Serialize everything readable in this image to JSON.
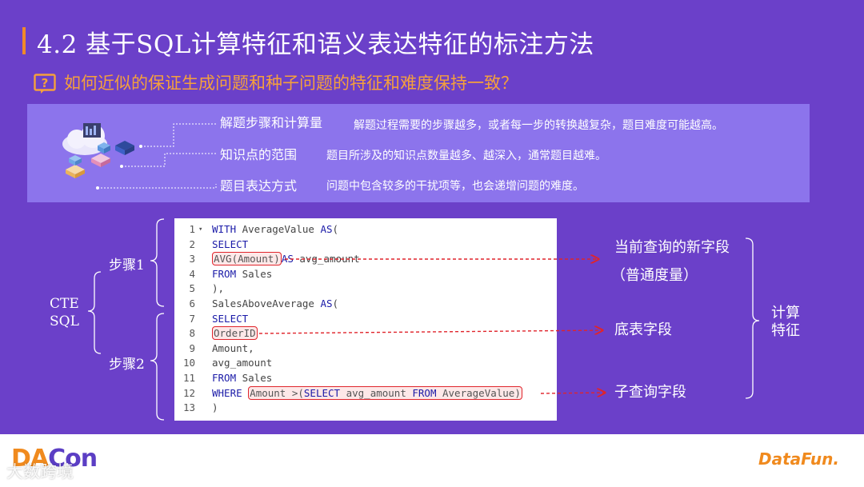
{
  "slide": {
    "title": "4.2 基于SQL计算特征和语义表达特征的标注方法",
    "question": "如何近似的保证生成问题和种子问题的特征和难度保持一致？",
    "question_icon": "question-box-icon",
    "accent_color": "#f0892a",
    "background_color": "#6b40c9"
  },
  "factors": [
    {
      "label": "解题步骤和计算量",
      "description": "解题过程需要的步骤越多，或者每一步的转换越复杂，题目难度可能越高。"
    },
    {
      "label": "知识点的范围",
      "description": "题目所涉及的知识点数量越多、越深入，通常题目越难。"
    },
    {
      "label": "题目表达方式",
      "description": "问题中包含较多的干扰项等，也会递增问题的难度。"
    }
  ],
  "code": {
    "lines": [
      {
        "num": "1",
        "fold": "▾",
        "pre": "",
        "kw": "WITH",
        "rest": " AverageValue ",
        "kw2": "AS",
        "post": "("
      },
      {
        "num": "2",
        "fold": "",
        "pre": "",
        "kw": "SELECT",
        "rest": "",
        "kw2": "",
        "post": ""
      },
      {
        "num": "3",
        "fold": "",
        "pre": "",
        "kw": "",
        "rest": "",
        "kw2": "",
        "post": ""
      },
      {
        "num": "4",
        "fold": "",
        "pre": "",
        "kw": "FROM",
        "rest": " Sales",
        "kw2": "",
        "post": ""
      },
      {
        "num": "5",
        "fold": "",
        "pre": "),",
        "kw": "",
        "rest": "",
        "kw2": "",
        "post": ""
      },
      {
        "num": "6",
        "fold": "",
        "pre": "SalesAboveAverage ",
        "kw": "AS",
        "rest": "(",
        "kw2": "",
        "post": ""
      },
      {
        "num": "7",
        "fold": "",
        "pre": "",
        "kw": "SELECT",
        "rest": "",
        "kw2": "",
        "post": ""
      },
      {
        "num": "8",
        "fold": "",
        "pre": "",
        "kw": "",
        "rest": "",
        "kw2": "",
        "post": ""
      },
      {
        "num": "9",
        "fold": "",
        "pre": "Amount,",
        "kw": "",
        "rest": "",
        "kw2": "",
        "post": ""
      },
      {
        "num": "10",
        "fold": "",
        "pre": "avg_amount",
        "kw": "",
        "rest": "",
        "kw2": "",
        "post": ""
      },
      {
        "num": "11",
        "fold": "",
        "pre": "",
        "kw": "FROM",
        "rest": " Sales",
        "kw2": "",
        "post": ""
      },
      {
        "num": "12",
        "fold": "",
        "pre": "",
        "kw": "WHERE",
        "rest": " ",
        "kw2": "",
        "post": ""
      },
      {
        "num": "13",
        "fold": "",
        "pre": ")",
        "kw": "",
        "rest": "",
        "kw2": "",
        "post": ""
      }
    ],
    "line3_highlight": "AVG(Amount)",
    "line3_kw": "AS",
    "line3_rest": " avg_amount",
    "line8_highlight": "OrderID",
    "line12_hl_pre": "Amount >(",
    "line12_hl_kw1": "SELECT",
    "line12_hl_mid": " avg_amount ",
    "line12_hl_kw2": "FROM",
    "line12_hl_post": " AverageValue)"
  },
  "annotations": {
    "step1": "步骤1",
    "step2": "步骤2",
    "cte_line1": "CTE",
    "cte_line2": "SQL",
    "feature_new_field_line1": "当前查询的新字段",
    "feature_new_field_line2": "（普通度量）",
    "feature_base_field": "底表字段",
    "feature_subquery_field": "子查询字段",
    "calc_line1": "计算",
    "calc_line2": "特征"
  },
  "footer": {
    "logo_left_a": "DA",
    "logo_left_b": "Con",
    "watermark": "大数跨境",
    "logo_right": "DataFun."
  }
}
